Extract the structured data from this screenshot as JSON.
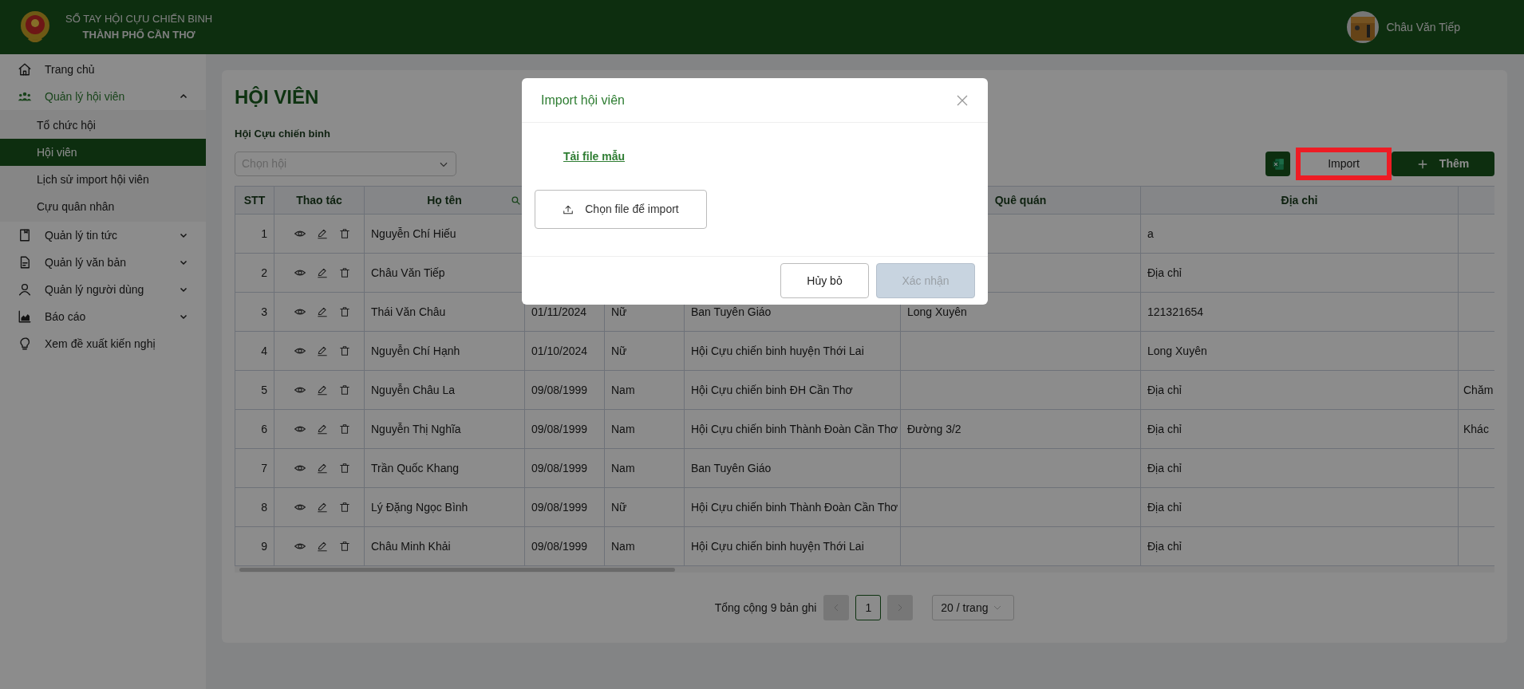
{
  "header": {
    "title_line_1": "SỔ TAY HỘI CỰU CHIẾN BINH",
    "title_line_2": "THÀNH PHỐ CẦN THƠ",
    "user_name": "Châu Văn Tiếp"
  },
  "sidebar": {
    "items": [
      {
        "label": "Trang chủ"
      },
      {
        "label": "Quản lý hội viên",
        "expanded": true,
        "children": [
          {
            "label": "Tổ chức hội",
            "selected": false
          },
          {
            "label": "Hội viên",
            "selected": true
          },
          {
            "label": "Lịch sử import hội viên",
            "selected": false
          },
          {
            "label": "Cựu quân nhân",
            "selected": false
          }
        ]
      },
      {
        "label": "Quản lý tin tức",
        "expanded": false
      },
      {
        "label": "Quản lý văn bản",
        "expanded": false
      },
      {
        "label": "Quản lý người dùng",
        "expanded": false
      },
      {
        "label": "Báo cáo",
        "expanded": false
      },
      {
        "label": "Xem đề xuất kiến nghị"
      }
    ]
  },
  "page": {
    "title": "HỘI VIÊN",
    "filter_label": "Hội Cựu chiến binh",
    "filter_select": {
      "placeholder": "Chọn hội"
    },
    "import_button": {
      "label": "Import",
      "highlighted": true
    },
    "add_button": {
      "label": "Thêm"
    }
  },
  "table": {
    "columns": {
      "stt": "STT",
      "actions": "Thao tác",
      "name": "Họ tên",
      "hometown": "Quê quán",
      "address": "Địa chỉ"
    },
    "rows": [
      {
        "stt": "1",
        "name": "Nguyễn Chí Hiếu",
        "address": "a"
      },
      {
        "stt": "2",
        "name": "Châu Văn Tiếp",
        "address": "Địa chỉ"
      },
      {
        "stt": "3",
        "name": "Thái Văn Châu",
        "column_4": "01/11/2024",
        "column_5": "Nữ",
        "column_6": "Ban Tuyên Giáo",
        "hometown": "Long Xuyên",
        "address": "121321654"
      },
      {
        "stt": "4",
        "name": "Nguyễn Chí Hạnh",
        "column_4": "01/10/2024",
        "column_5": "Nữ",
        "column_6": "Hội Cựu chiến binh huyện Thới Lai",
        "address": "Long Xuyên"
      },
      {
        "stt": "5",
        "name": "Nguyễn Châu La",
        "column_4": "09/08/1999",
        "column_5": "Nam",
        "column_6": "Hội Cựu chiến binh ĐH Cần Thơ",
        "address": "Địa chỉ",
        "column_9": "Chăm"
      },
      {
        "stt": "6",
        "name": "Nguyễn Thị Nghĩa",
        "column_4": "09/08/1999",
        "column_5": "Nam",
        "column_6": "Hội Cựu chiến binh Thành Đoàn Cần Thơ",
        "hometown": "Đường 3/2",
        "address": "Địa chỉ",
        "column_9": "Khác"
      },
      {
        "stt": "7",
        "name": "Trần Quốc Khang",
        "column_4": "09/08/1999",
        "column_5": "Nam",
        "column_6": "Ban Tuyên Giáo",
        "address": "Địa chỉ"
      },
      {
        "stt": "8",
        "name": "Lý Đặng Ngọc Bình",
        "column_4": "09/08/1999",
        "column_5": "Nữ",
        "column_6": "Hội Cựu chiến binh Thành Đoàn Cần Thơ",
        "address": "Địa chỉ"
      },
      {
        "stt": "9",
        "name": "Châu Minh Khải",
        "column_4": "09/08/1999",
        "column_5": "Nam",
        "column_6": "Hội Cựu chiến binh huyện Thới Lai",
        "address": "Địa chỉ"
      }
    ]
  },
  "pagination": {
    "total": "Tổng cộng 9 bản ghi",
    "prev_disabled": true,
    "pages": [
      {
        "label": "1",
        "selected": true
      }
    ],
    "next_disabled": true,
    "page_size": "20 / trang"
  },
  "modal": {
    "title": "Import hội viên",
    "template_link": "Tải file mẫu",
    "upload_button": "Chọn file để import",
    "cancel_button": "Hủy bỏ",
    "confirm_button": {
      "label": "Xác nhận",
      "disabled": true
    }
  }
}
